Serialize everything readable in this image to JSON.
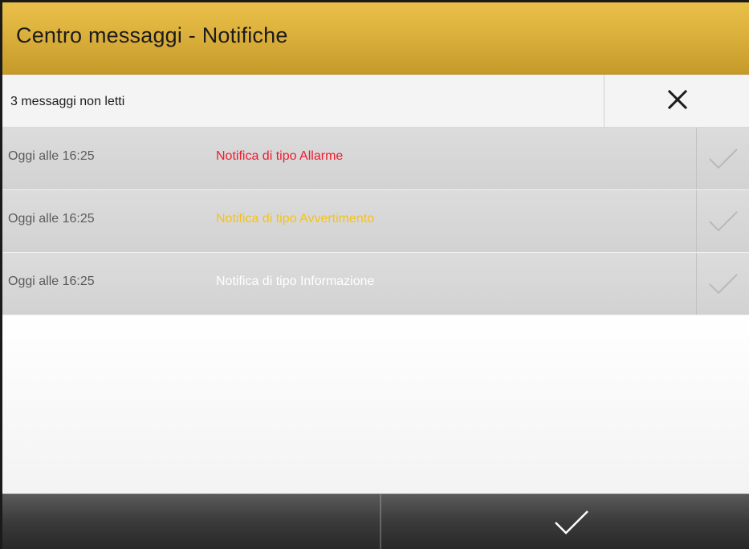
{
  "header": {
    "title": "Centro messaggi - Notifiche"
  },
  "status": {
    "unread_text": "3 messaggi non letti",
    "close_icon": "close-icon"
  },
  "notifications": [
    {
      "time": "Oggi alle 16:25",
      "message": "Notifica di tipo Allarme",
      "color": "#ee1c2e",
      "action_icon": "check-icon"
    },
    {
      "time": "Oggi alle 16:25",
      "message": "Notifica di tipo Avvertimento",
      "color": "#f5c21b",
      "action_icon": "check-icon"
    },
    {
      "time": "Oggi alle 16:25",
      "message": "Notifica di tipo Informazione",
      "color": "#ffffff",
      "action_icon": "check-icon"
    }
  ],
  "footer": {
    "confirm_icon": "check-icon"
  },
  "colors": {
    "header_accent": "#dcb03c",
    "footer_dark": "#3c3c3c"
  }
}
